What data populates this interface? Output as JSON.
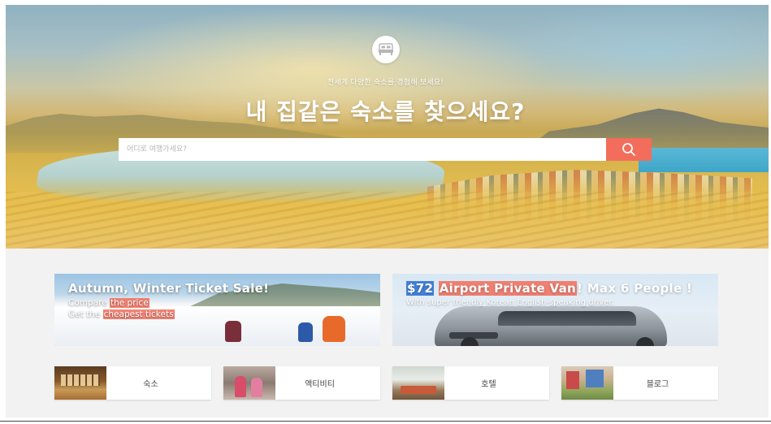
{
  "hero": {
    "subtitle": "전세계 다양한 숙소를 경험해 보세요!",
    "title": "내 집같은 숙소를 찾으세요?",
    "icon": "bed-icon"
  },
  "search": {
    "placeholder": "어디로 여행가세요?",
    "value": "",
    "button_icon": "search-icon"
  },
  "colors": {
    "accent": "#f26d5b",
    "highlight_blue": "#286ed2",
    "background": "#f2f2f2"
  },
  "banners": {
    "ski": {
      "title": "Autumn, Winter Ticket Sale!",
      "line1_prefix": "Compare ",
      "line1_highlight": "the price",
      "line2_prefix": "Get the ",
      "line2_highlight": "cheapest tickets"
    },
    "van": {
      "price": "$72",
      "title_highlight": "Airport Private Van",
      "title_rest": "! Max 6 People !",
      "subtitle": "With super friendly Korean English-speaking driver."
    }
  },
  "categories": [
    {
      "label": "숙소"
    },
    {
      "label": "액티비티"
    },
    {
      "label": "호텔"
    },
    {
      "label": "블로그"
    }
  ]
}
